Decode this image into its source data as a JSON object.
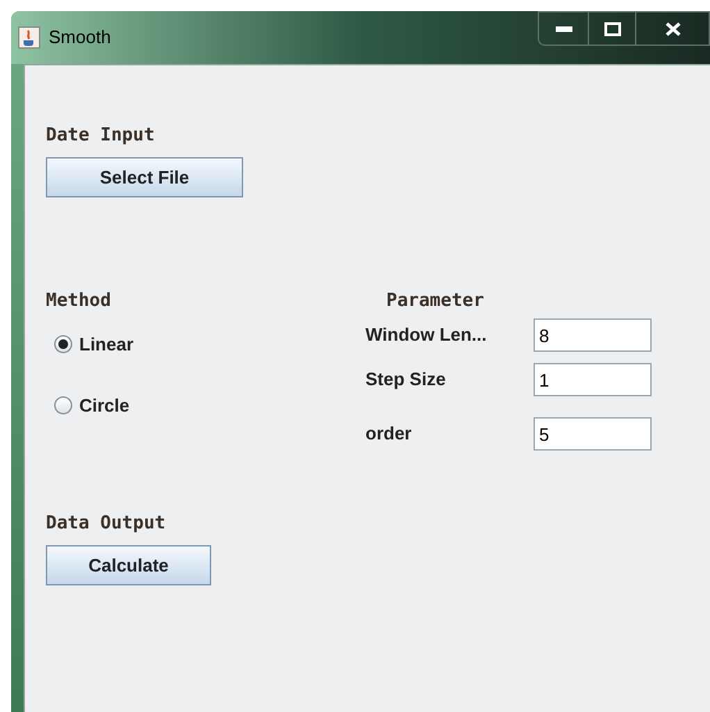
{
  "window": {
    "title": "Smooth"
  },
  "input_section": {
    "heading": "Date Input",
    "button": "Select File"
  },
  "method": {
    "heading": "Method",
    "options": [
      {
        "label": "Linear",
        "selected": true
      },
      {
        "label": "Circle",
        "selected": false
      }
    ]
  },
  "parameter": {
    "heading": "Parameter",
    "fields": [
      {
        "label": "Window Len...",
        "value": "8"
      },
      {
        "label": "Step Size",
        "value": "1"
      },
      {
        "label": "order",
        "value": "5"
      }
    ]
  },
  "output_section": {
    "heading": "Data Output",
    "button": "Calculate"
  }
}
